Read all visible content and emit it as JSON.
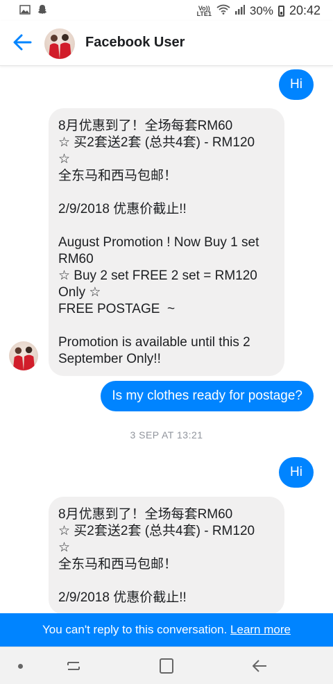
{
  "status_bar": {
    "volte_top": "Vo))",
    "volte_bottom": "LTE1",
    "battery_percent": "30%",
    "time": "20:42",
    "icons": [
      "gallery-icon",
      "snapchat-icon",
      "volte-icon",
      "wifi-icon",
      "signal-icon",
      "battery-icon"
    ]
  },
  "header": {
    "title": "Facebook User",
    "back_icon": "back-arrow-icon"
  },
  "messages": {
    "m1": "Hi",
    "m2": "8月优惠到了！全场每套RM60\n☆ 买2套送2套 (总共4套) - RM120\n☆\n全东马和西马包邮！\n\n2/9/2018 优惠价截止!!\n\nAugust Promotion ! Now Buy 1 set\nRM60\n☆ Buy 2 set FREE 2 set = RM120\nOnly ☆\nFREE POSTAGE  ~\n\nPromotion is available until this 2\nSeptember Only!!",
    "m3": "Is my clothes ready for postage?",
    "timestamp": "3 SEP AT 13:21",
    "m4": "Hi",
    "m5": "8月优惠到了！全场每套RM60\n☆ 买2套送2套 (总共4套) - RM120\n☆\n全东马和西马包邮！\n\n2/9/2018 优惠价截止!!"
  },
  "notice": {
    "text": "You can't reply to this conversation.",
    "link": "Learn more"
  },
  "colors": {
    "accent": "#0084ff",
    "incoming_bubble": "#f1f0f0",
    "text": "#1c1e21"
  }
}
